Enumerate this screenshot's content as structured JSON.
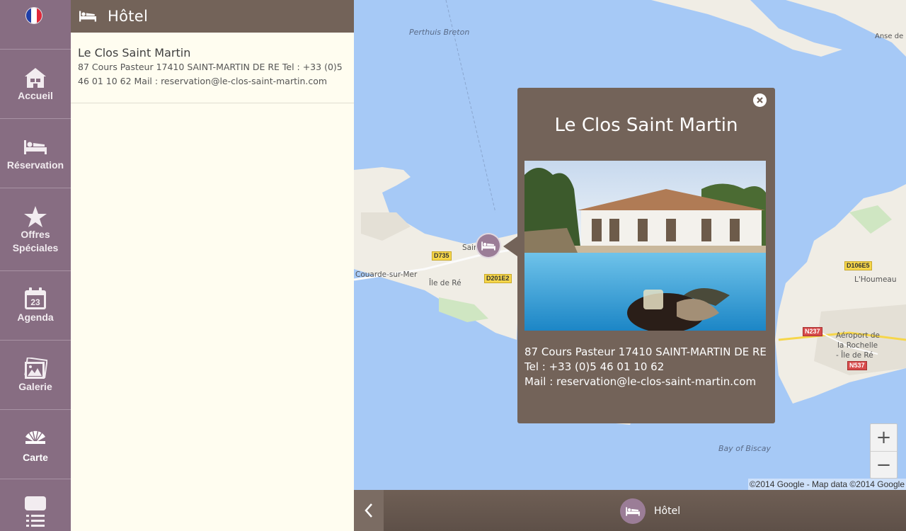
{
  "nav": {
    "language_flag": "flag-fr-icon",
    "items": [
      {
        "label": "Accueil",
        "icon": "house-icon"
      },
      {
        "label": "Réservation",
        "icon": "bed-icon"
      },
      {
        "label": "Offres Spéciales",
        "icon": "star-icon"
      },
      {
        "label": "Agenda",
        "icon": "calendar-icon",
        "icon_text": "23"
      },
      {
        "label": "Galerie",
        "icon": "gallery-icon"
      },
      {
        "label": "Carte",
        "icon": "map-fan-icon",
        "active": true
      },
      {
        "label": "",
        "icon": "list-icon"
      }
    ]
  },
  "panel": {
    "header": {
      "title": "Hôtel",
      "icon": "bed-icon"
    },
    "items": [
      {
        "name": "Le Clos Saint Martin",
        "description": "87 Cours Pasteur 17410 SAINT-MARTIN DE RE  Tel : +33 (0)5 46 01 10 62 Mail : reservation@le-clos-saint-martin.com"
      }
    ]
  },
  "map": {
    "labels": {
      "perthuis": "Perthuis Breton",
      "anse": "Anse de l'A",
      "couarde": "Couarde-sur-Mer",
      "ile_de_re": "Île de Ré",
      "saint_martin": "Sain",
      "houmeau": "L'Houmeau",
      "aeroport": "Aéroport de",
      "rochelle": "la Rochelle",
      "ile_de_re2": "- Île de Ré",
      "biscay": "Bay of Biscay"
    },
    "roads": {
      "d735": "D735",
      "d201e2": "D201E2",
      "d106e5": "D106E5",
      "n237": "N237",
      "n537": "N537"
    },
    "copyright": "©2014 Google - Map data ©2014 Google",
    "zoom_in": "+",
    "zoom_out": "−",
    "colors": {
      "water": "#a6c9f6",
      "land": "#f0ede5",
      "accent": "#736359",
      "marker": "#9b7d97"
    }
  },
  "popup": {
    "title": "Le Clos Saint Martin",
    "address": "87 Cours Pasteur 17410 SAINT-MARTIN DE RE",
    "tel": "Tel : +33 (0)5 46 01 10 62",
    "mail": "Mail : reservation@le-clos-saint-martin.com"
  },
  "bottombar": {
    "label": "Hôtel",
    "icon": "bed-icon",
    "back_icon": "chevron-left-icon"
  }
}
